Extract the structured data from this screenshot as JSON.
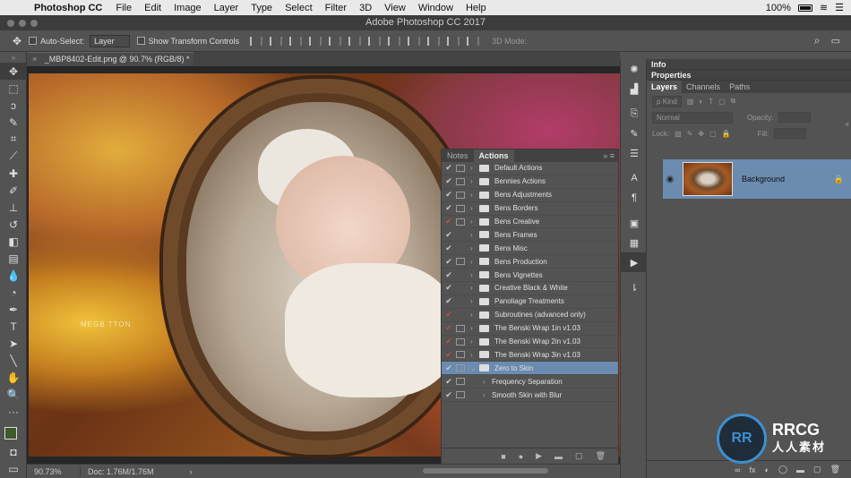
{
  "menubar": {
    "apple": "",
    "app": "Photoshop CC",
    "items": [
      "File",
      "Edit",
      "Image",
      "Layer",
      "Type",
      "Select",
      "Filter",
      "3D",
      "View",
      "Window",
      "Help"
    ],
    "battery": "100%"
  },
  "window": {
    "title": "Adobe Photoshop CC 2017"
  },
  "options": {
    "auto_select_label": "Auto-Select:",
    "auto_select_value": "Layer",
    "transform_label": "Show Transform Controls",
    "mode3d": "3D Mode:"
  },
  "doc_tab": {
    "label": "_MBP8402-Edit.png @ 90.7% (RGB/8) *",
    "close": "×"
  },
  "status": {
    "zoom": "90.73%",
    "doc": "Doc: 1.76M/1.76M",
    "arrow": "›"
  },
  "photo": {
    "watermark": "MEGB TTON"
  },
  "actions_panel": {
    "tabs": [
      "Notes",
      "Actions"
    ],
    "active_tab": "Actions",
    "menu_label": "»  ≡",
    "rows": [
      {
        "label": "Default Actions",
        "check": "✔",
        "red": false,
        "dialog": true,
        "type": "set"
      },
      {
        "label": "Bennies Actions",
        "check": "✔",
        "red": false,
        "dialog": true,
        "type": "set"
      },
      {
        "label": "Bens Adjustments",
        "check": "✔",
        "red": false,
        "dialog": true,
        "type": "set"
      },
      {
        "label": "Bens Borders",
        "check": "✔",
        "red": false,
        "dialog": true,
        "type": "set"
      },
      {
        "label": "Bens Creative",
        "check": "✔",
        "red": true,
        "dialog": true,
        "type": "set"
      },
      {
        "label": "Bens Frames",
        "check": "✔",
        "red": false,
        "dialog": false,
        "type": "set"
      },
      {
        "label": "Bens Misc",
        "check": "✔",
        "red": false,
        "dialog": false,
        "type": "set"
      },
      {
        "label": "Bens Production",
        "check": "✔",
        "red": false,
        "dialog": true,
        "type": "set"
      },
      {
        "label": "Bens Vignettes",
        "check": "✔",
        "red": false,
        "dialog": false,
        "type": "set"
      },
      {
        "label": "Creative Black & White",
        "check": "✔",
        "red": false,
        "dialog": false,
        "type": "set"
      },
      {
        "label": "Panoliage Treatments",
        "check": "✔",
        "red": false,
        "dialog": false,
        "type": "set"
      },
      {
        "label": "Subroutines (advanced only)",
        "check": "✔",
        "red": true,
        "dialog": false,
        "type": "set"
      },
      {
        "label": "The Benski Wrap 1in v1.03",
        "check": "✔",
        "red": true,
        "dialog": true,
        "type": "set"
      },
      {
        "label": "The Benski Wrap 2in v1.03",
        "check": "✔",
        "red": true,
        "dialog": true,
        "type": "set"
      },
      {
        "label": "The Benski Wrap 3in v1.03",
        "check": "✔",
        "red": true,
        "dialog": true,
        "type": "set"
      },
      {
        "label": "Zero to Skin",
        "check": "✔",
        "red": false,
        "dialog": true,
        "type": "open",
        "selected": true
      },
      {
        "label": "Frequency Separation",
        "check": "✔",
        "red": false,
        "dialog": true,
        "type": "action"
      },
      {
        "label": "Smooth Skin with Blur",
        "check": "✔",
        "red": false,
        "dialog": true,
        "type": "action"
      }
    ],
    "footer": [
      "■",
      "●",
      "▶",
      "▬",
      "▢",
      "🗑"
    ]
  },
  "right_panel": {
    "info": "Info",
    "properties": "Properties",
    "tabs": [
      "Layers",
      "Channels",
      "Paths"
    ],
    "active_tab": "Layers",
    "kind": "ρ Kind",
    "blend": "Normal",
    "opacity_label": "Opacity:",
    "lock_label": "Lock:",
    "fill_label": "Fill:",
    "layer_name": "Background",
    "footer": [
      "∞",
      "fx",
      "◐",
      "◯",
      "▬",
      "▢",
      "🗑"
    ]
  },
  "logo": {
    "mark": "RR",
    "line1": "RRCG",
    "line2": "人人素材"
  }
}
